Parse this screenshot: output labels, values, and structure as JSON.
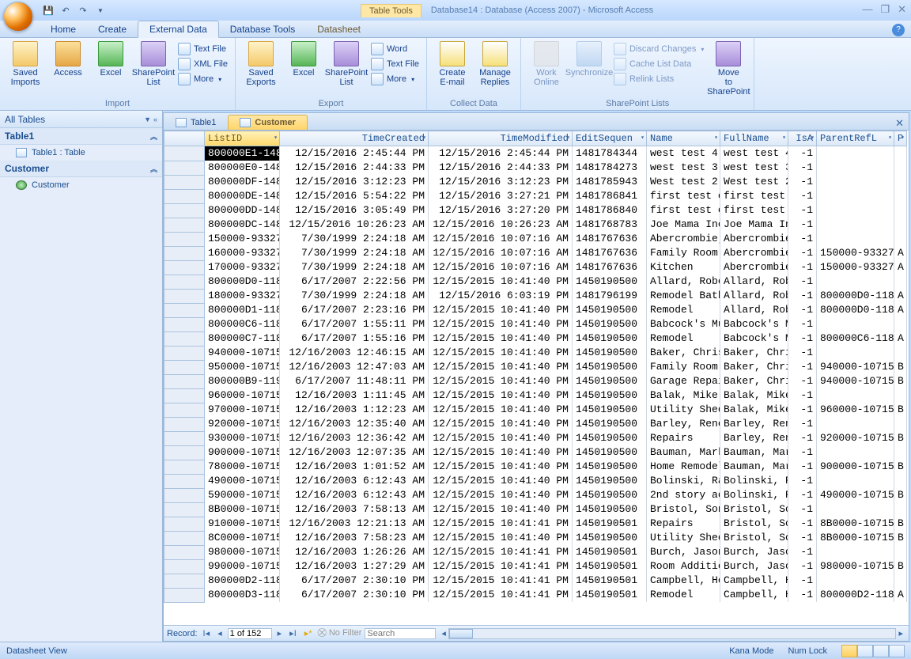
{
  "title": {
    "context": "Table Tools",
    "text": "Database14 : Database (Access 2007) - Microsoft Access"
  },
  "tabs": [
    "Home",
    "Create",
    "External Data",
    "Database Tools",
    "Datasheet"
  ],
  "activeTab": 2,
  "ribbon": {
    "groups": [
      {
        "label": "Import",
        "big": [
          {
            "label": "Saved Imports",
            "icon": "folder"
          },
          {
            "label": "Access",
            "icon": "key"
          },
          {
            "label": "Excel",
            "icon": "excel"
          },
          {
            "label": "SharePoint List",
            "icon": "sp"
          }
        ],
        "small": [
          {
            "label": "Text File"
          },
          {
            "label": "XML File"
          },
          {
            "label": "More",
            "dd": true
          }
        ]
      },
      {
        "label": "Export",
        "big": [
          {
            "label": "Saved Exports",
            "icon": "folder"
          },
          {
            "label": "Excel",
            "icon": "excel"
          },
          {
            "label": "SharePoint List",
            "icon": "sp"
          }
        ],
        "small": [
          {
            "label": "Word"
          },
          {
            "label": "Text File"
          },
          {
            "label": "More",
            "dd": true
          }
        ]
      },
      {
        "label": "Collect Data",
        "big": [
          {
            "label": "Create E-mail",
            "icon": "mail"
          },
          {
            "label": "Manage Replies",
            "icon": "mail"
          }
        ],
        "small": []
      },
      {
        "label": "SharePoint Lists",
        "big": [
          {
            "label": "Work Online",
            "icon": "gray",
            "disabled": true
          },
          {
            "label": "Synchronize",
            "icon": "sync",
            "disabled": true
          }
        ],
        "small": [
          {
            "label": "Discard Changes",
            "dd": true,
            "disabled": true
          },
          {
            "label": "Cache List Data",
            "disabled": true
          },
          {
            "label": "Relink Lists",
            "disabled": true
          }
        ],
        "big2": [
          {
            "label": "Move to SharePoint",
            "icon": "sp"
          }
        ]
      }
    ]
  },
  "nav": {
    "header": "All Tables",
    "groups": [
      {
        "title": "Table1",
        "items": [
          {
            "label": "Table1 : Table",
            "icon": "table"
          }
        ]
      },
      {
        "title": "Customer",
        "items": [
          {
            "label": "Customer",
            "icon": "globe"
          }
        ]
      }
    ]
  },
  "docTabs": [
    {
      "label": "Table1"
    },
    {
      "label": "Customer",
      "active": true
    }
  ],
  "columns": [
    {
      "key": "ListID",
      "cls": "col-listid",
      "active": true
    },
    {
      "key": "TimeCreated",
      "cls": "col-tc"
    },
    {
      "key": "TimeModified",
      "cls": "col-tm"
    },
    {
      "key": "EditSequen",
      "cls": "col-es"
    },
    {
      "key": "Name",
      "cls": "col-name"
    },
    {
      "key": "FullName",
      "cls": "col-fn"
    },
    {
      "key": "IsA",
      "cls": "col-is"
    },
    {
      "key": "ParentRefL",
      "cls": "col-pr"
    },
    {
      "key": "P",
      "cls": "col-p"
    }
  ],
  "rows": [
    [
      "800000E1-148",
      "12/15/2016 2:45:44 PM",
      "12/15/2016 2:45:44 PM",
      "1481784344",
      "west test 4",
      "west test 4",
      "-1",
      "",
      ""
    ],
    [
      "800000E0-148",
      "12/15/2016 2:44:33 PM",
      "12/15/2016 2:44:33 PM",
      "1481784273",
      "west test 3",
      "west test 3",
      "-1",
      "",
      ""
    ],
    [
      "800000DF-148",
      "12/15/2016 3:12:23 PM",
      "12/15/2016 3:12:23 PM",
      "1481785943",
      "West test 2",
      "West test 2",
      "-1",
      "",
      ""
    ],
    [
      "800000DE-148",
      "12/15/2016 5:54:22 PM",
      "12/15/2016 3:27:21 PM",
      "1481786841",
      "first test c",
      "first test c",
      "-1",
      "",
      ""
    ],
    [
      "800000DD-148",
      "12/15/2016 3:05:49 PM",
      "12/15/2016 3:27:20 PM",
      "1481786840",
      "first test c",
      "first test c",
      "-1",
      "",
      ""
    ],
    [
      "800000DC-148",
      "12/15/2016 10:26:23 AM",
      "12/15/2016 10:26:23 AM",
      "1481768783",
      "Joe Mama Inc",
      "Joe Mama Inc",
      "-1",
      "",
      ""
    ],
    [
      "150000-93327",
      "7/30/1999 2:24:18 AM",
      "12/15/2016 10:07:16 AM",
      "1481767636",
      "Abercrombie,",
      "Abercrombie,",
      "-1",
      "",
      ""
    ],
    [
      "160000-93327",
      "7/30/1999 2:24:18 AM",
      "12/15/2016 10:07:16 AM",
      "1481767636",
      "Family Room",
      "Abercrombie,",
      "-1",
      "150000-93327",
      "A"
    ],
    [
      "170000-93327",
      "7/30/1999 2:24:18 AM",
      "12/15/2016 10:07:16 AM",
      "1481767636",
      "Kitchen",
      "Abercrombie,",
      "-1",
      "150000-93327",
      "A"
    ],
    [
      "800000D0-118",
      "6/17/2007 2:22:56 PM",
      "12/15/2015 10:41:40 PM",
      "1450190500",
      "Allard, Robe",
      "Allard, Robe",
      "-1",
      "",
      ""
    ],
    [
      "180000-93327",
      "7/30/1999 2:24:18 AM",
      "12/15/2016 6:03:19 PM",
      "1481796199",
      "Remodel Bath",
      "Allard, Robe",
      "-1",
      "800000D0-118",
      "A"
    ],
    [
      "800000D1-118",
      "6/17/2007 2:23:16 PM",
      "12/15/2015 10:41:40 PM",
      "1450190500",
      "Remodel",
      "Allard, Robe",
      "-1",
      "800000D0-118",
      "A"
    ],
    [
      "800000C6-118",
      "6/17/2007 1:55:11 PM",
      "12/15/2015 10:41:40 PM",
      "1450190500",
      "Babcock's Mu",
      "Babcock's Mu",
      "-1",
      "",
      ""
    ],
    [
      "800000C7-118",
      "6/17/2007 1:55:16 PM",
      "12/15/2015 10:41:40 PM",
      "1450190500",
      "Remodel",
      "Babcock's Mu",
      "-1",
      "800000C6-118",
      "A"
    ],
    [
      "940000-10715",
      "12/16/2003 12:46:15 AM",
      "12/15/2015 10:41:40 PM",
      "1450190500",
      "Baker, Chris",
      "Baker, Chris",
      "-1",
      "",
      ""
    ],
    [
      "950000-10715",
      "12/16/2003 12:47:03 AM",
      "12/15/2015 10:41:40 PM",
      "1450190500",
      "Family Room",
      "Baker, Chris",
      "-1",
      "940000-10715",
      "B"
    ],
    [
      "800000B9-119",
      "6/17/2007 11:48:11 PM",
      "12/15/2015 10:41:40 PM",
      "1450190500",
      "Garage Repai",
      "Baker, Chris",
      "-1",
      "940000-10715",
      "B"
    ],
    [
      "960000-10715",
      "12/16/2003 1:11:45 AM",
      "12/15/2015 10:41:40 PM",
      "1450190500",
      "Balak, Mike",
      "Balak, Mike",
      "-1",
      "",
      ""
    ],
    [
      "970000-10715",
      "12/16/2003 1:12:23 AM",
      "12/15/2015 10:41:40 PM",
      "1450190500",
      "Utility Shed",
      "Balak, Mike",
      "-1",
      "960000-10715",
      "B"
    ],
    [
      "920000-10715",
      "12/16/2003 12:35:40 AM",
      "12/15/2015 10:41:40 PM",
      "1450190500",
      "Barley, Rene",
      "Barley, Rene",
      "-1",
      "",
      ""
    ],
    [
      "930000-10715",
      "12/16/2003 12:36:42 AM",
      "12/15/2015 10:41:40 PM",
      "1450190500",
      "Repairs",
      "Barley, Rene",
      "-1",
      "920000-10715",
      "B"
    ],
    [
      "900000-10715",
      "12/16/2003 12:07:35 AM",
      "12/15/2015 10:41:40 PM",
      "1450190500",
      "Bauman, Mark",
      "Bauman, Mark",
      "-1",
      "",
      ""
    ],
    [
      "780000-10715",
      "12/16/2003 1:01:52 AM",
      "12/15/2015 10:41:40 PM",
      "1450190500",
      "Home Remodel",
      "Bauman, Mark",
      "-1",
      "900000-10715",
      "B"
    ],
    [
      "490000-10715",
      "12/16/2003 6:12:43 AM",
      "12/15/2015 10:41:40 PM",
      "1450190500",
      "Bolinski, Ra",
      "Bolinski, Ra",
      "-1",
      "",
      ""
    ],
    [
      "590000-10715",
      "12/16/2003 6:12:43 AM",
      "12/15/2015 10:41:40 PM",
      "1450190500",
      "2nd story ad",
      "Bolinski, Ra",
      "-1",
      "490000-10715",
      "B"
    ],
    [
      "8B0000-10715",
      "12/16/2003 7:58:13 AM",
      "12/15/2015 10:41:40 PM",
      "1450190500",
      "Bristol, Son",
      "Bristol, Son",
      "-1",
      "",
      ""
    ],
    [
      "910000-10715",
      "12/16/2003 12:21:13 AM",
      "12/15/2015 10:41:41 PM",
      "1450190501",
      "Repairs",
      "Bristol, Son",
      "-1",
      "8B0000-10715",
      "B"
    ],
    [
      "8C0000-10715",
      "12/16/2003 7:58:23 AM",
      "12/15/2015 10:41:40 PM",
      "1450190500",
      "Utility Shed",
      "Bristol, Son",
      "-1",
      "8B0000-10715",
      "B"
    ],
    [
      "980000-10715",
      "12/16/2003 1:26:26 AM",
      "12/15/2015 10:41:41 PM",
      "1450190501",
      "Burch, Jason",
      "Burch, Jason",
      "-1",
      "",
      ""
    ],
    [
      "990000-10715",
      "12/16/2003 1:27:29 AM",
      "12/15/2015 10:41:41 PM",
      "1450190501",
      "Room Additio",
      "Burch, Jason",
      "-1",
      "980000-10715",
      "B"
    ],
    [
      "800000D2-118",
      "6/17/2007 2:30:10 PM",
      "12/15/2015 10:41:41 PM",
      "1450190501",
      "Campbell, He",
      "Campbell, He",
      "-1",
      "",
      ""
    ],
    [
      "800000D3-118",
      "6/17/2007 2:30:10 PM",
      "12/15/2015 10:41:41 PM",
      "1450190501",
      "Remodel",
      "Campbell, He",
      "-1",
      "800000D2-118",
      "A"
    ]
  ],
  "recnav": {
    "label": "Record:",
    "pos": "1 of 152",
    "filter": "No Filter",
    "search": "Search"
  },
  "status": {
    "left": "Datasheet View",
    "kana": "Kana Mode",
    "num": "Num Lock"
  }
}
